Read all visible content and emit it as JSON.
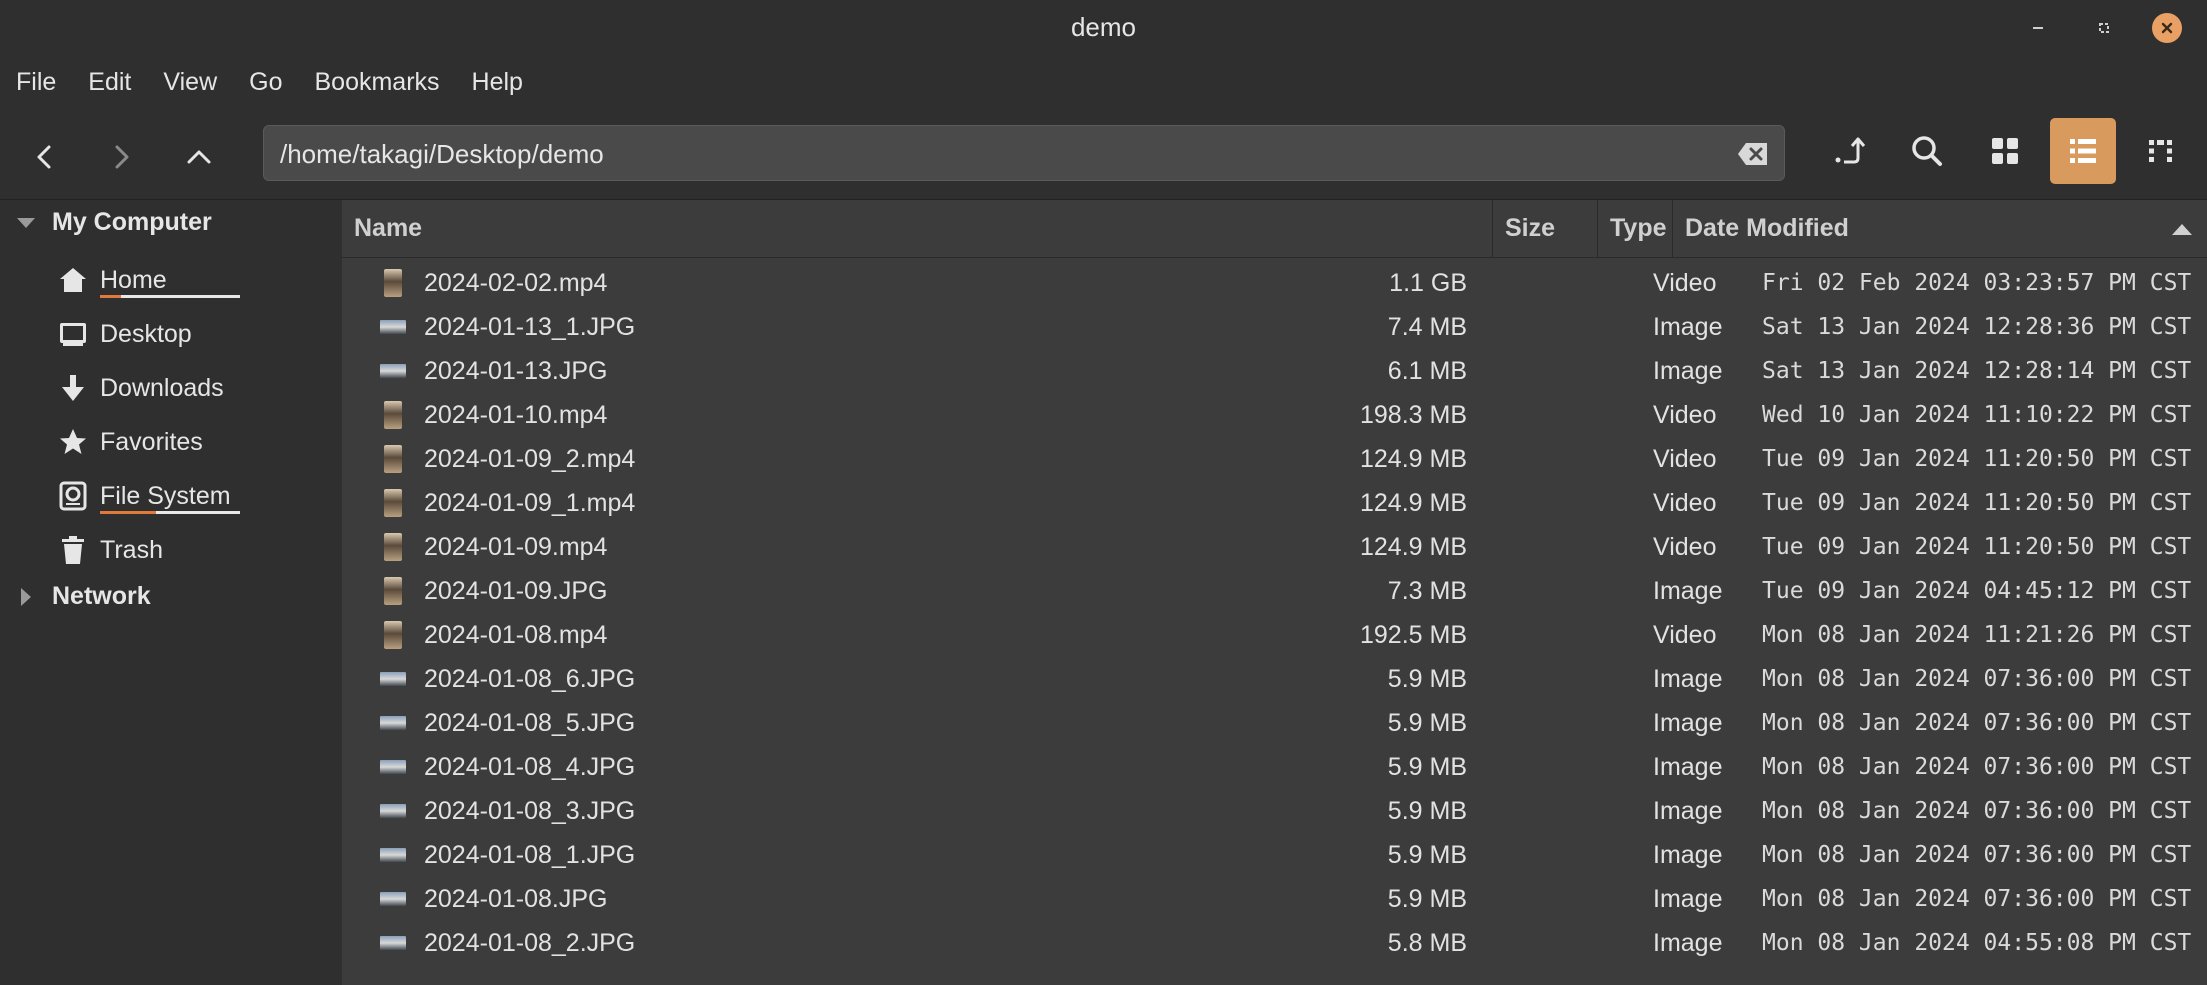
{
  "window": {
    "title": "demo"
  },
  "menu": [
    "File",
    "Edit",
    "View",
    "Go",
    "Bookmarks",
    "Help"
  ],
  "location": {
    "path": "/home/takagi/Desktop/demo"
  },
  "sidebar": {
    "my_computer": "My Computer",
    "items": [
      {
        "label": "Home",
        "icon": "home-icon",
        "usage_fraction": 0.15
      },
      {
        "label": "Desktop",
        "icon": "desktop-icon"
      },
      {
        "label": "Downloads",
        "icon": "download-icon"
      },
      {
        "label": "Favorites",
        "icon": "star-icon"
      },
      {
        "label": "File System",
        "icon": "drive-icon",
        "usage_fraction": 0.4
      },
      {
        "label": "Trash",
        "icon": "trash-icon"
      }
    ],
    "network": "Network"
  },
  "columns": {
    "name": "Name",
    "size": "Size",
    "type": "Type",
    "date": "Date Modified"
  },
  "files": [
    {
      "name": "2024-02-02.mp4",
      "size": "1.1 GB",
      "type": "Video",
      "date": "Fri 02 Feb 2024 03:23:57 PM CST",
      "kind": "video"
    },
    {
      "name": "2024-01-13_1.JPG",
      "size": "7.4 MB",
      "type": "Image",
      "date": "Sat 13 Jan 2024 12:28:36 PM CST",
      "kind": "image"
    },
    {
      "name": "2024-01-13.JPG",
      "size": "6.1 MB",
      "type": "Image",
      "date": "Sat 13 Jan 2024 12:28:14 PM CST",
      "kind": "image"
    },
    {
      "name": "2024-01-10.mp4",
      "size": "198.3 MB",
      "type": "Video",
      "date": "Wed 10 Jan 2024 11:10:22 PM CST",
      "kind": "video"
    },
    {
      "name": "2024-01-09_2.mp4",
      "size": "124.9 MB",
      "type": "Video",
      "date": "Tue 09 Jan 2024 11:20:50 PM CST",
      "kind": "video"
    },
    {
      "name": "2024-01-09_1.mp4",
      "size": "124.9 MB",
      "type": "Video",
      "date": "Tue 09 Jan 2024 11:20:50 PM CST",
      "kind": "video"
    },
    {
      "name": "2024-01-09.mp4",
      "size": "124.9 MB",
      "type": "Video",
      "date": "Tue 09 Jan 2024 11:20:50 PM CST",
      "kind": "video"
    },
    {
      "name": "2024-01-09.JPG",
      "size": "7.3 MB",
      "type": "Image",
      "date": "Tue 09 Jan 2024 04:45:12 PM CST",
      "kind": "video"
    },
    {
      "name": "2024-01-08.mp4",
      "size": "192.5 MB",
      "type": "Video",
      "date": "Mon 08 Jan 2024 11:21:26 PM CST",
      "kind": "video"
    },
    {
      "name": "2024-01-08_6.JPG",
      "size": "5.9 MB",
      "type": "Image",
      "date": "Mon 08 Jan 2024 07:36:00 PM CST",
      "kind": "image"
    },
    {
      "name": "2024-01-08_5.JPG",
      "size": "5.9 MB",
      "type": "Image",
      "date": "Mon 08 Jan 2024 07:36:00 PM CST",
      "kind": "image"
    },
    {
      "name": "2024-01-08_4.JPG",
      "size": "5.9 MB",
      "type": "Image",
      "date": "Mon 08 Jan 2024 07:36:00 PM CST",
      "kind": "image"
    },
    {
      "name": "2024-01-08_3.JPG",
      "size": "5.9 MB",
      "type": "Image",
      "date": "Mon 08 Jan 2024 07:36:00 PM CST",
      "kind": "image"
    },
    {
      "name": "2024-01-08_1.JPG",
      "size": "5.9 MB",
      "type": "Image",
      "date": "Mon 08 Jan 2024 07:36:00 PM CST",
      "kind": "image"
    },
    {
      "name": "2024-01-08.JPG",
      "size": "5.9 MB",
      "type": "Image",
      "date": "Mon 08 Jan 2024 07:36:00 PM CST",
      "kind": "image"
    },
    {
      "name": "2024-01-08_2.JPG",
      "size": "5.8 MB",
      "type": "Image",
      "date": "Mon 08 Jan 2024 04:55:08 PM CST",
      "kind": "image"
    }
  ],
  "colors": {
    "accent": "#d99a5e",
    "close": "#e8a065",
    "usage": "#e07a3a"
  }
}
